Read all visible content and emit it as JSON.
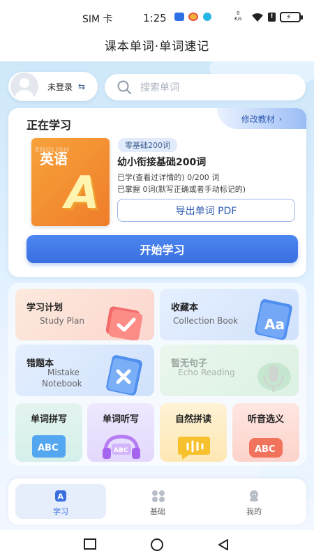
{
  "status_bar": {
    "sim": "SIM 卡",
    "time": "1:25",
    "network_speed_top": "0",
    "network_speed_unit": "K/s"
  },
  "header": {
    "title": "课本单词·单词速记"
  },
  "user": {
    "login_label": "未登录"
  },
  "search": {
    "placeholder": "搜索单词"
  },
  "learning": {
    "section_title": "正在学习",
    "edit_label": "修改教材",
    "cover_title": "英语",
    "cover_eng": "ENGLISH",
    "cover_letter": "A",
    "level_tag": "零基础200词",
    "book_name": "幼小衔接基础200词",
    "learned_stat": "已学(查看过详情的) 0/200 词",
    "mastered_stat": "已掌握 0词(默写正确或者手动标记的)",
    "export_label": "导出单词 PDF",
    "start_label": "开始学习"
  },
  "features": {
    "plan": {
      "title": "学习计划",
      "subtitle": "Study Plan"
    },
    "collection": {
      "title": "收藏本",
      "subtitle": "Collection Book",
      "icon_text": "Aa"
    },
    "mistakes": {
      "title": "错题本",
      "subtitle_line1": "Mistake",
      "subtitle_line2": "Notebook"
    },
    "echo": {
      "title": "暂无句子",
      "subtitle": "Echo Reading"
    },
    "small": [
      {
        "title": "单词拼写",
        "badge": "ABC"
      },
      {
        "title": "单词听写",
        "badge": "ABC"
      },
      {
        "title": "自然拼读",
        "badge": ""
      },
      {
        "title": "听音选义",
        "badge": "ABC"
      }
    ]
  },
  "nav": {
    "study": "学习",
    "basic": "基础",
    "mine": "我的",
    "active": "study"
  },
  "colors": {
    "accent": "#3a6fe0",
    "background": "#dcefff"
  }
}
